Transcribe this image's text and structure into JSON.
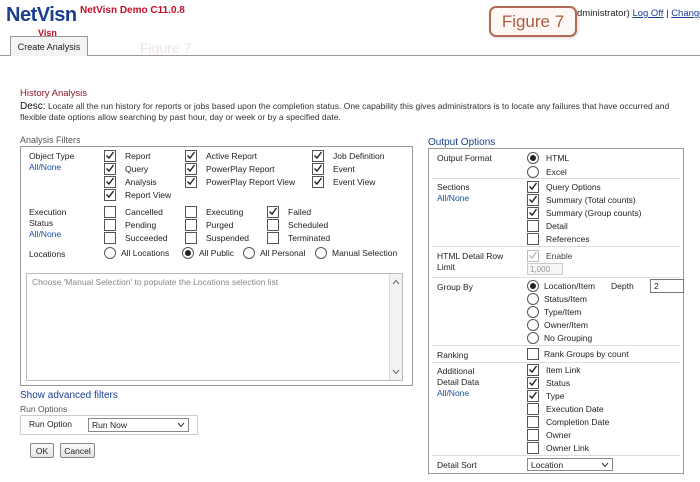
{
  "header": {
    "logo_main": "NetVisn",
    "logo_sub": "Visn",
    "app_version": "NetVisn Demo C11.0.8",
    "figure_badge": "Figure 7",
    "user_suffix": "dministrator)",
    "logoff_link": "Log Off",
    "separator": "|",
    "change_link": "Change",
    "ghost_figure": "Figure 7"
  },
  "tabs": {
    "create_analysis": "Create Analysis"
  },
  "page": {
    "title": "History Analysis",
    "desc_label": "Desc:",
    "desc_text": "Locate all the run history for reports or jobs based upon the completion status. One capability this gives administrators is to locate any failures that have occurred and flexible date options allow searching by past hour, day or week or by a specified date."
  },
  "filters": {
    "title": "Analysis Filters",
    "object_type": {
      "label": "Object Type",
      "all_none": "All/None",
      "items": [
        {
          "label": "Report",
          "checked": true
        },
        {
          "label": "Query",
          "checked": true
        },
        {
          "label": "Analysis",
          "checked": true
        },
        {
          "label": "Report View",
          "checked": true
        },
        {
          "label": "Active Report",
          "checked": true
        },
        {
          "label": "PowerPlay Report",
          "checked": true
        },
        {
          "label": "PowerPlay Report View",
          "checked": true
        },
        {
          "label": "Job Definition",
          "checked": true
        },
        {
          "label": "Event",
          "checked": true
        },
        {
          "label": "Event View",
          "checked": true
        }
      ]
    },
    "execution_status": {
      "label_line1": "Execution",
      "label_line2": "Status",
      "all_none": "All/None",
      "items": [
        {
          "label": "Cancelled",
          "checked": false
        },
        {
          "label": "Pending",
          "checked": false
        },
        {
          "label": "Succeeded",
          "checked": false
        },
        {
          "label": "Executing",
          "checked": false
        },
        {
          "label": "Purged",
          "checked": false
        },
        {
          "label": "Suspended",
          "checked": false
        },
        {
          "label": "Failed",
          "checked": true
        },
        {
          "label": "Scheduled",
          "checked": false
        },
        {
          "label": "Terminated",
          "checked": false
        }
      ]
    },
    "locations": {
      "label": "Locations",
      "options": [
        "All Locations",
        "All Public",
        "All Personal",
        "Manual Selection"
      ],
      "selected": "All Public",
      "placeholder": "Choose 'Manual Selection' to populate the Locations selection list"
    }
  },
  "advanced": {
    "link": "Show advanced filters",
    "run_options_title": "Run Options",
    "run_option_label": "Run Option",
    "run_option_value": "Run Now"
  },
  "buttons": {
    "ok": "OK",
    "cancel": "Cancel"
  },
  "output": {
    "title": "Output Options",
    "format": {
      "label": "Output Format",
      "options": [
        "HTML",
        "Excel"
      ],
      "selected": "HTML"
    },
    "sections": {
      "label": "Sections",
      "all_none": "All/None",
      "items": [
        {
          "label": "Query Options",
          "checked": true
        },
        {
          "label": "Summary (Total counts)",
          "checked": true
        },
        {
          "label": "Summary (Group counts)",
          "checked": true
        },
        {
          "label": "Detail",
          "checked": false
        },
        {
          "label": "References",
          "checked": false
        }
      ]
    },
    "html_limit": {
      "label_line1": "HTML Detail Row",
      "label_line2": "Limit",
      "enable_label": "Enable",
      "enable_checked": true,
      "value": "1,000"
    },
    "group_by": {
      "label": "Group By",
      "options": [
        "Location/Item",
        "Status/Item",
        "Type/Item",
        "Owner/Item",
        "No Grouping"
      ],
      "selected": "Location/Item",
      "depth_label": "Depth",
      "depth_value": "2"
    },
    "ranking": {
      "label": "Ranking",
      "option_label": "Rank Groups by count",
      "checked": false
    },
    "additional": {
      "label_line1": "Additional",
      "label_line2": "Detail Data",
      "all_none": "All/None",
      "items": [
        {
          "label": "Item Link",
          "checked": true
        },
        {
          "label": "Status",
          "checked": true
        },
        {
          "label": "Type",
          "checked": true
        },
        {
          "label": "Execution Date",
          "checked": false
        },
        {
          "label": "Completion Date",
          "checked": false
        },
        {
          "label": "Owner",
          "checked": false
        },
        {
          "label": "Owner Link",
          "checked": false
        }
      ]
    },
    "detail_sort": {
      "label": "Detail Sort",
      "value": "Location"
    }
  }
}
